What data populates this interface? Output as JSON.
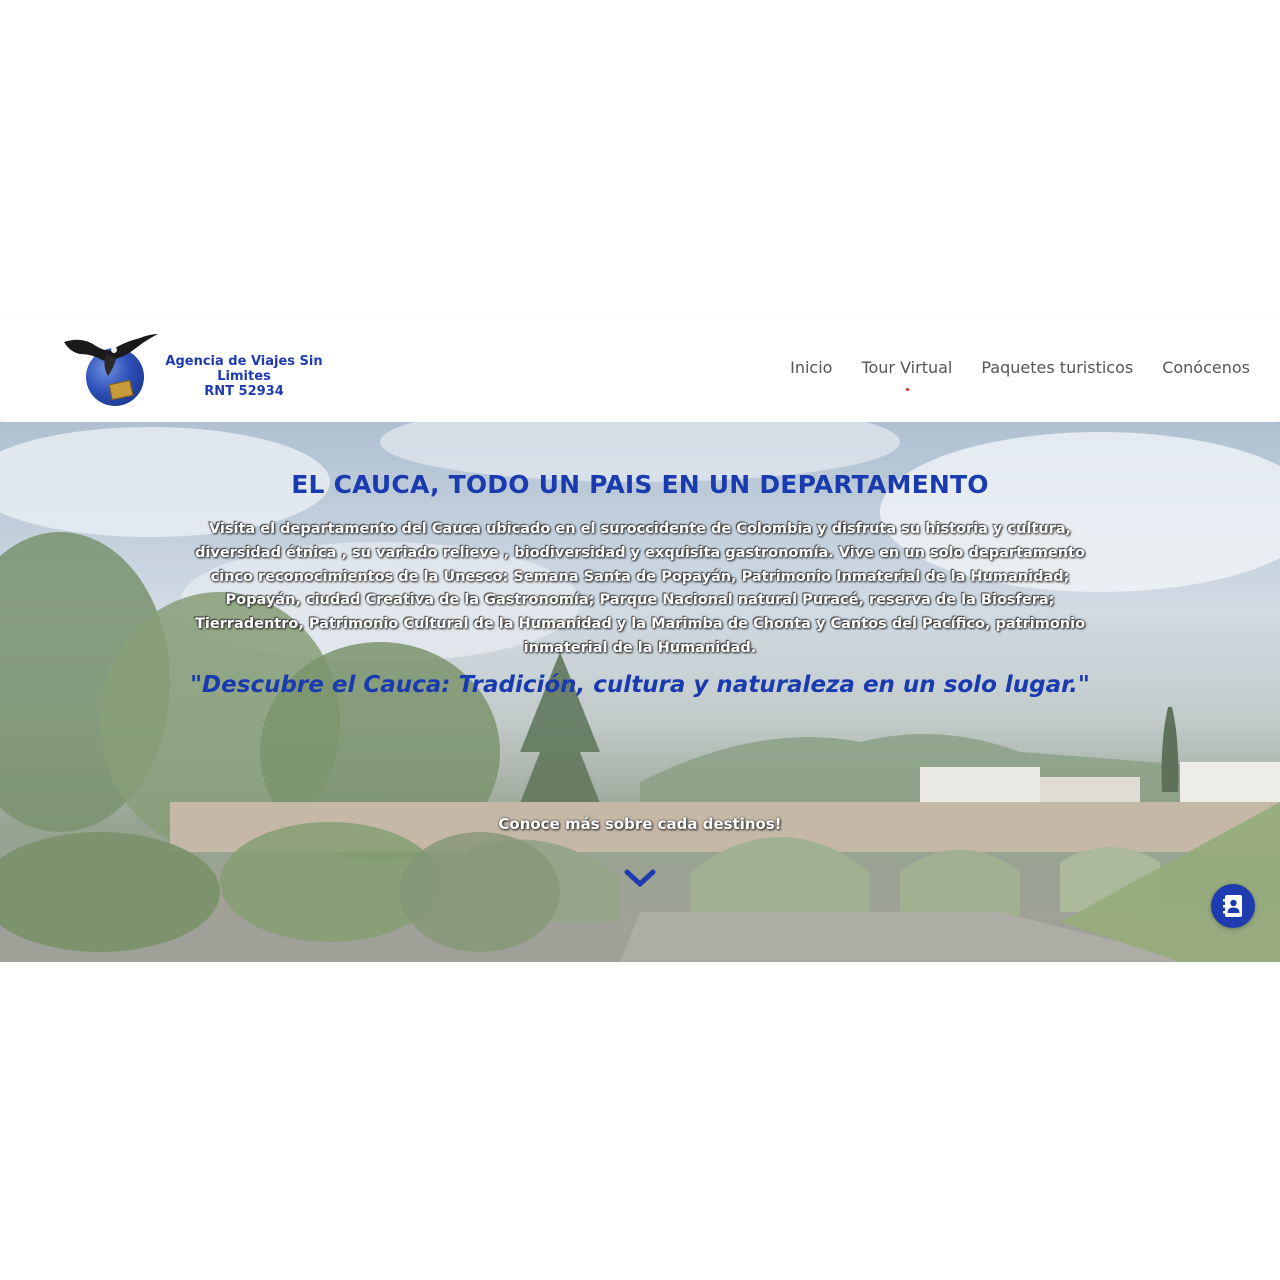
{
  "brand": {
    "name": "Agencia de Viajes Sin Limites",
    "rnt": "RNT 52934",
    "box_text": "SIN LIMITES",
    "color": "#1f3bb0"
  },
  "nav": {
    "items": [
      {
        "label": "Inicio",
        "active": false
      },
      {
        "label": "Tour Virtual",
        "active": true
      },
      {
        "label": "Paquetes turisticos",
        "active": false
      },
      {
        "label": "Conócenos",
        "active": false
      }
    ]
  },
  "hero": {
    "title": "EL CAUCA, TODO UN PAIS EN UN DEPARTAMENTO",
    "description": "Visita el departamento del Cauca ubicado en el suroccidente de Colombia y disfruta su historia y cultura, diversidad étnica , su variado relieve , biodiversidad y exquisita gastronomía. Vive en un solo departamento cinco reconocimientos de la Unesco: Semana Santa de Popayán, Patrimonio Inmaterial de la Humanidad; Popayán, ciudad Creativa de la Gastronomía; Parque Nacional natural Puracé, reserva de la Biosfera; Tierradentro, Patrimonio Cultural de la Humanidad y la Marimba de Chonta y Cantos del Pacífico, patrimonio inmaterial de la Humanidad.",
    "quote": "\"Descubre el Cauca: Tradición, cultura y naturaleza en un solo lugar.\"",
    "more_text": "Conoce más sobre cada destinos!",
    "scroll_icon": "chevron-down-icon",
    "contact_icon": "contact-book-icon",
    "accent_color": "#1a3bb0"
  }
}
